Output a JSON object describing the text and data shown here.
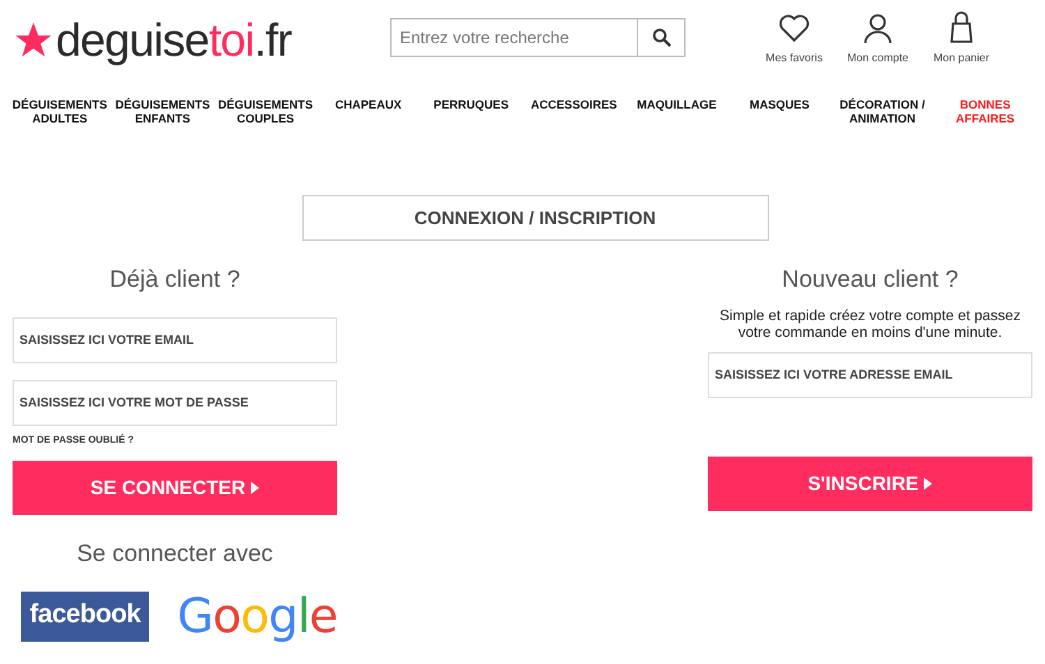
{
  "header": {
    "logo": [
      {
        "text": "deguise",
        "highlight": false
      },
      {
        "text": "toi",
        "highlight": true
      },
      {
        "text": ".fr",
        "highlight": false
      }
    ],
    "search": {
      "placeholder": "Entrez votre recherche"
    },
    "actions": [
      {
        "kind": "heart",
        "label": "Mes favoris"
      },
      {
        "kind": "user",
        "label": "Mon compte"
      },
      {
        "kind": "bag",
        "label": "Mon panier"
      }
    ]
  },
  "nav": [
    {
      "label": "DÉGUISEMENTS ADULTES",
      "highlight": false
    },
    {
      "label": "DÉGUISEMENTS ENFANTS",
      "highlight": false
    },
    {
      "label": "DÉGUISEMENTS COUPLES",
      "highlight": false
    },
    {
      "label": "CHAPEAUX",
      "highlight": false
    },
    {
      "label": "PERRUQUES",
      "highlight": false
    },
    {
      "label": "ACCESSOIRES",
      "highlight": false
    },
    {
      "label": "MAQUILLAGE",
      "highlight": false
    },
    {
      "label": "MASQUES",
      "highlight": false
    },
    {
      "label": "DÉCORATION / ANIMATION",
      "highlight": false
    },
    {
      "label": "BONNES AFFAIRES",
      "highlight": true
    }
  ],
  "page_title": "CONNEXION / INSCRIPTION",
  "login": {
    "title": "Déjà client ?",
    "fields": [
      {
        "placeholder": "SAISISSEZ ICI VOTRE EMAIL"
      },
      {
        "placeholder": "SAISISSEZ ICI VOTRE MOT DE PASSE"
      }
    ],
    "forgot": "MOT DE PASSE OUBLIÉ ?",
    "button": "SE CONNECTER",
    "social_title": "Se connecter avec",
    "social": [
      {
        "kind": "facebook",
        "label": "facebook"
      },
      {
        "kind": "google",
        "label": "Google"
      }
    ]
  },
  "register": {
    "title": "Nouveau client ?",
    "text": "Simple et rapide créez votre compte et passez votre commande en moins d'une minute.",
    "field": {
      "placeholder": "SAISISSEZ ICI VOTRE ADRESSE EMAIL"
    },
    "button": "S'INSCRIRE"
  }
}
